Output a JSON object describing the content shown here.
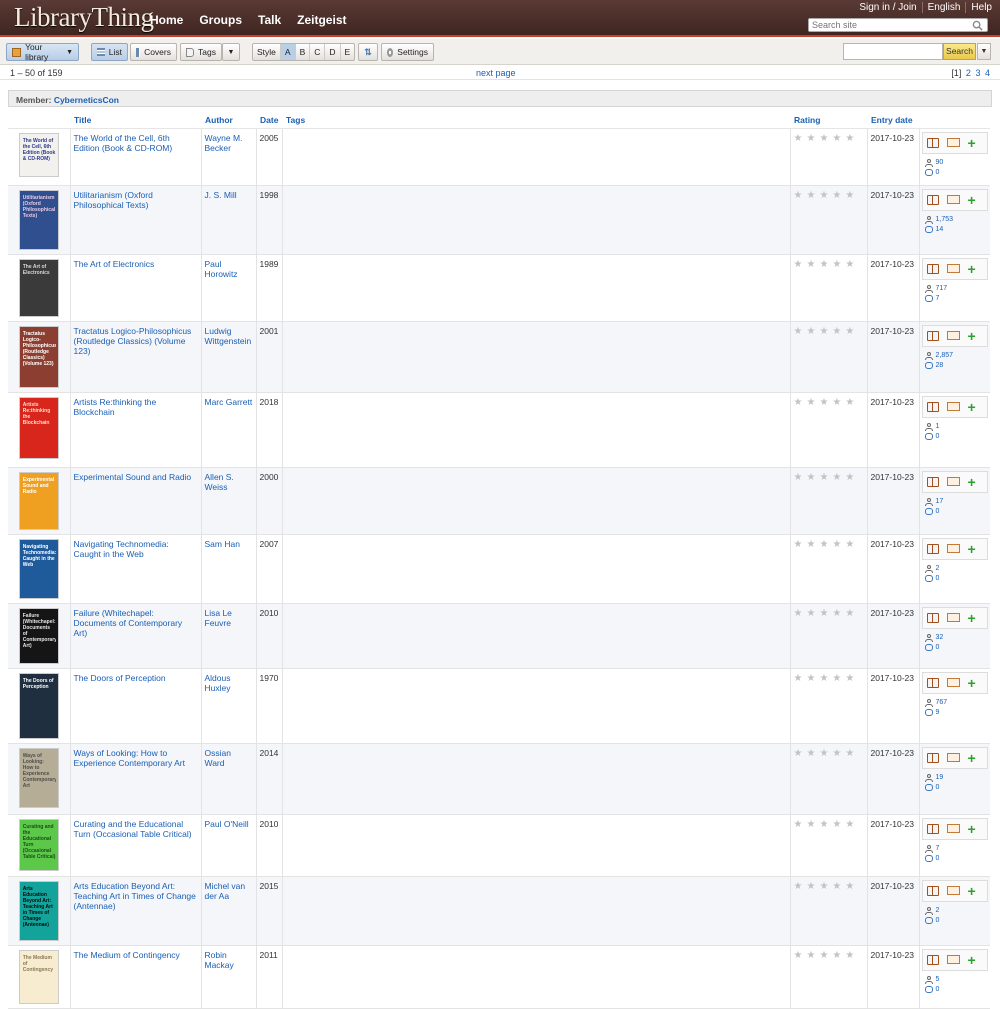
{
  "header": {
    "logo": "LibraryThing",
    "nav": [
      "Home",
      "Groups",
      "Talk",
      "Zeitgeist"
    ],
    "top_links": [
      "Sign in / Join",
      "English",
      "Help"
    ],
    "search_placeholder": "Search site"
  },
  "toolbar": {
    "your_library": "Your library",
    "list": "List",
    "covers": "Covers",
    "tags": "Tags",
    "style": "Style",
    "styles": [
      "A",
      "B",
      "C",
      "D",
      "E"
    ],
    "settings": "Settings",
    "search_button": "Search"
  },
  "pager": {
    "range": "1 – 50 of 159",
    "next": "next page",
    "current_page": "[1]",
    "pages": [
      "2",
      "3",
      "4"
    ]
  },
  "member": {
    "label": "Member:",
    "name": "CyberneticsCon"
  },
  "columns": {
    "title": "Title",
    "author": "Author",
    "date": "Date",
    "tags": "Tags",
    "rating": "Rating",
    "entry_date": "Entry date"
  },
  "books": [
    {
      "title": "The World of the Cell, 6th Edition (Book & CD-ROM)",
      "author": "Wayne M. Becker",
      "date": "2005",
      "entry": "2017-10-23",
      "members": "90",
      "reviews": "0",
      "cover_bg": "#f3f1ee",
      "cover_fg": "#2b3a8a"
    },
    {
      "title": "Utilitarianism (Oxford Philosophical Texts)",
      "author": "J. S. Mill",
      "date": "1998",
      "entry": "2017-10-23",
      "members": "1,753",
      "reviews": "14",
      "cover_bg": "#2f4f8f",
      "cover_fg": "#e8c9e6"
    },
    {
      "title": "The Art of Electronics",
      "author": "Paul Horowitz",
      "date": "1989",
      "entry": "2017-10-23",
      "members": "717",
      "reviews": "7",
      "cover_bg": "#3a3a3a",
      "cover_fg": "#d8d8d8"
    },
    {
      "title": "Tractatus Logico-Philosophicus (Routledge Classics) (Volume 123)",
      "author": "Ludwig Wittgenstein",
      "date": "2001",
      "entry": "2017-10-23",
      "members": "2,857",
      "reviews": "28",
      "cover_bg": "#8c3f30",
      "cover_fg": "#ffffff"
    },
    {
      "title": "Artists Re:thinking the Blockchain",
      "author": "Marc Garrett",
      "date": "2018",
      "entry": "2017-10-23",
      "members": "1",
      "reviews": "0",
      "cover_bg": "#d8261c",
      "cover_fg": "#ffd9c9"
    },
    {
      "title": "Experimental Sound and Radio",
      "author": "Allen S. Weiss",
      "date": "2000",
      "entry": "2017-10-23",
      "members": "17",
      "reviews": "0",
      "cover_bg": "#f0a020",
      "cover_fg": "#ffffff"
    },
    {
      "title": "Navigating Technomedia: Caught in the Web",
      "author": "Sam Han",
      "date": "2007",
      "entry": "2017-10-23",
      "members": "2",
      "reviews": "0",
      "cover_bg": "#1f5a9a",
      "cover_fg": "#ffffff"
    },
    {
      "title": "Failure (Whitechapel: Documents of Contemporary Art)",
      "author": "Lisa Le Feuvre",
      "date": "2010",
      "entry": "2017-10-23",
      "members": "32",
      "reviews": "0",
      "cover_bg": "#151515",
      "cover_fg": "#e6e6e6"
    },
    {
      "title": "The Doors of Perception",
      "author": "Aldous Huxley",
      "date": "1970",
      "entry": "2017-10-23",
      "members": "767",
      "reviews": "9",
      "cover_bg": "#1f2f3f",
      "cover_fg": "#ffffff"
    },
    {
      "title": "Ways of Looking: How to Experience Contemporary Art",
      "author": "Ossian Ward",
      "date": "2014",
      "entry": "2017-10-23",
      "members": "19",
      "reviews": "0",
      "cover_bg": "#b5ad95",
      "cover_fg": "#4d4d4d"
    },
    {
      "title": "Curating and the Educational Turn (Occasional Table Critical)",
      "author": "Paul O'Neill",
      "date": "2010",
      "entry": "2017-10-23",
      "members": "7",
      "reviews": "0",
      "cover_bg": "#5cc84a",
      "cover_fg": "#1f4a1a"
    },
    {
      "title": "Arts Education Beyond Art: Teaching Art in Times of Change (Antennae)",
      "author": "Michel van der Aa",
      "date": "2015",
      "entry": "2017-10-23",
      "members": "2",
      "reviews": "0",
      "cover_bg": "#12a39a",
      "cover_fg": "#0a0a0a"
    },
    {
      "title": "The Medium of Contingency",
      "author": "Robin Mackay",
      "date": "2011",
      "entry": "2017-10-23",
      "members": "5",
      "reviews": "0",
      "cover_bg": "#f7ecd0",
      "cover_fg": "#8a7a55"
    }
  ]
}
